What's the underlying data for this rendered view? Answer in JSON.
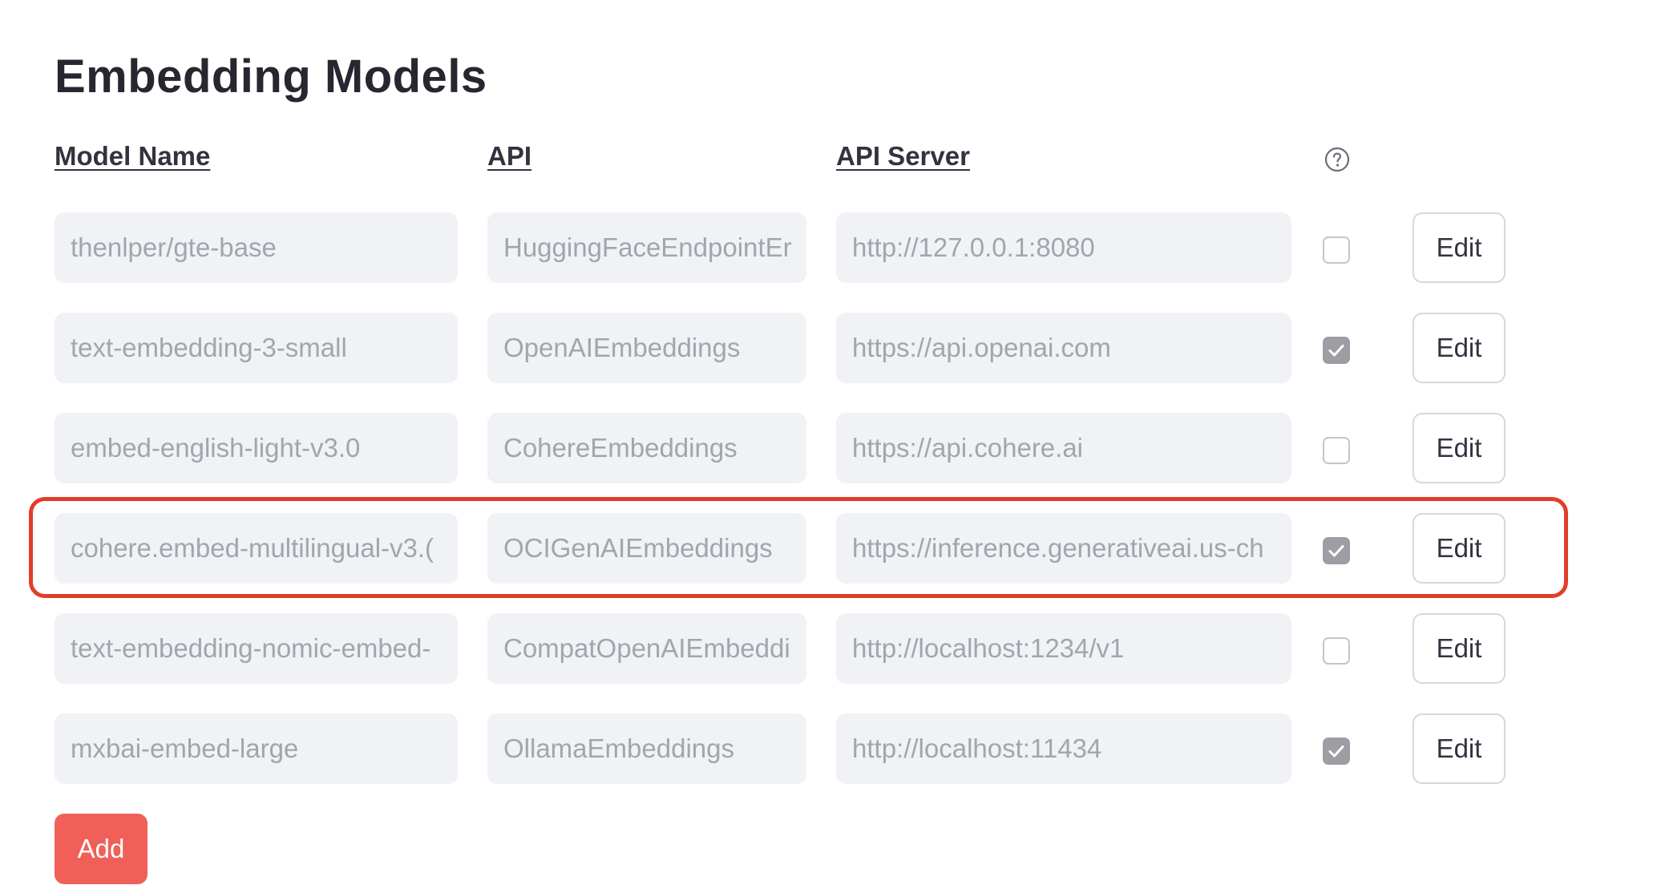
{
  "page": {
    "title": "Embedding Models"
  },
  "columns": {
    "model_name": "Model Name",
    "api": "API",
    "api_server": "API Server",
    "help_icon": "question-circle-icon"
  },
  "rows": [
    {
      "model_name": "thenlper/gte-base",
      "api": "HuggingFaceEndpointEr",
      "api_server": "http://127.0.0.1:8080",
      "checked": false,
      "edit_label": "Edit"
    },
    {
      "model_name": "text-embedding-3-small",
      "api": "OpenAIEmbeddings",
      "api_server": "https://api.openai.com",
      "checked": true,
      "edit_label": "Edit"
    },
    {
      "model_name": "embed-english-light-v3.0",
      "api": "CohereEmbeddings",
      "api_server": "https://api.cohere.ai",
      "checked": false,
      "edit_label": "Edit"
    },
    {
      "model_name": "cohere.embed-multilingual-v3.(",
      "api": "OCIGenAIEmbeddings",
      "api_server": "https://inference.generativeai.us-ch",
      "checked": true,
      "edit_label": "Edit"
    },
    {
      "model_name": "text-embedding-nomic-embed-",
      "api": "CompatOpenAIEmbeddi",
      "api_server": "http://localhost:1234/v1",
      "checked": false,
      "edit_label": "Edit"
    },
    {
      "model_name": "mxbai-embed-large",
      "api": "OllamaEmbeddings",
      "api_server": "http://localhost:11434",
      "checked": true,
      "edit_label": "Edit"
    }
  ],
  "actions": {
    "add_label": "Add"
  },
  "colors": {
    "highlight_border": "#e23d28",
    "add_button": "#f06059",
    "cell_background": "#f0f2f6",
    "checked_box": "#9d9ea4"
  }
}
